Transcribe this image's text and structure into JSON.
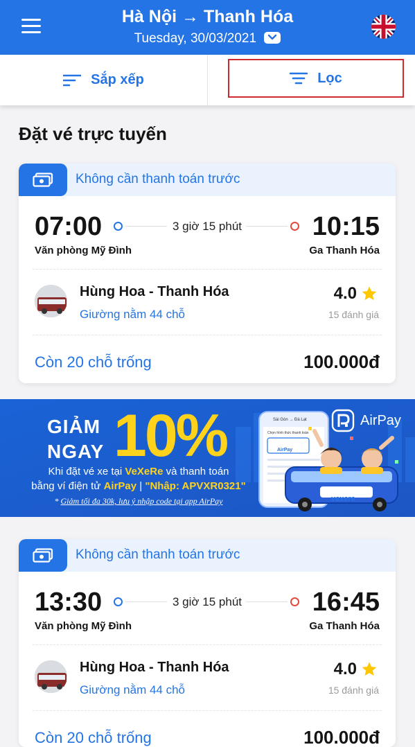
{
  "header": {
    "origin": "Hà Nội",
    "arrow": "→",
    "destination": "Thanh Hóa",
    "date": "Tuesday, 30/03/2021",
    "menu_icon": "hamburger-icon",
    "language_icon": "uk-flag-icon",
    "date_icon": "chevron-down-icon",
    "color": "#2474e5"
  },
  "toolbar": {
    "sort_label": "Sắp xếp",
    "filter_label": "Lọc",
    "sort_icon": "sort-lines-icon",
    "filter_icon": "filter-lines-icon",
    "highlight_color": "#d0282f"
  },
  "section_title": "Đặt vé trực tuyến",
  "trips": [
    {
      "payment_note": "Không cần thanh toán trước",
      "depart_time": "07:00",
      "arrive_time": "10:15",
      "duration": "3 giờ 15 phút",
      "depart_station": "Văn phòng Mỹ Đình",
      "arrive_station": "Ga Thanh Hóa",
      "operator": "Hùng Hoa - Thanh Hóa",
      "bus_type": "Giường nằm 44 chỗ",
      "rating": "4.0",
      "reviews": "15 đánh giá",
      "seats_left": "Còn 20 chỗ trống",
      "price": "100.000đ"
    },
    {
      "payment_note": "Không cần thanh toán trước",
      "depart_time": "13:30",
      "arrive_time": "16:45",
      "duration": "3 giờ 15 phút",
      "depart_station": "Văn phòng Mỹ Đình",
      "arrive_station": "Ga Thanh Hóa",
      "operator": "Hùng Hoa - Thanh Hóa",
      "bus_type": "Giường nằm 44 chỗ",
      "rating": "4.0",
      "reviews": "15 đánh giá",
      "seats_left": "Còn 20 chỗ trống",
      "price": "100.000đ"
    }
  ],
  "banner": {
    "giam": "GIẢM",
    "ngay": "NGAY",
    "percent": "10%",
    "line1_a": "Khi đặt vé xe tại ",
    "line1_brand": "VeXeRe",
    "line1_b": " và thanh toán",
    "line2_a": "bằng ví điện tử ",
    "line2_brand": "AirPay",
    "line2_sep": " | ",
    "line2_code": "\"Nhập: APVXR0321\"",
    "line3_star": "* ",
    "line3_note": "Giảm tối đa 30k, lưu ý nhập code tại app AirPay",
    "airpay_label": "AirPay",
    "vexere_label": "vexere",
    "phone_title": "Sài Gòn → Đà Lạt",
    "phone_heading": "Chọn hình thức thanh toán",
    "phone_airpay": "AirPay"
  }
}
